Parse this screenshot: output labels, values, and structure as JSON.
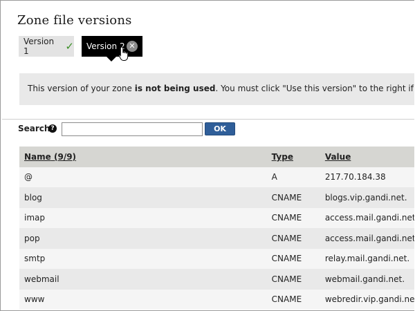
{
  "page": {
    "title": "Zone file versions"
  },
  "tabs": [
    {
      "label": "Version 1",
      "status_icon": "checkmark-icon"
    },
    {
      "label": "Version 2",
      "status_icon": "close-icon",
      "active": true
    }
  ],
  "notice": {
    "before": "This version of your zone ",
    "emphasis": "is not being used",
    "after": ". You must click \"Use this version\" to the right if you want to"
  },
  "search": {
    "label": "Search",
    "help_icon": "help-icon",
    "value": "",
    "ok_label": "OK"
  },
  "table": {
    "headers": {
      "name": "Name",
      "count": "(9/9)",
      "type": "Type",
      "value": "Value"
    },
    "rows": [
      {
        "name": "@",
        "type": "A",
        "value": "217.70.184.38"
      },
      {
        "name": "blog",
        "type": "CNAME",
        "value": "blogs.vip.gandi.net."
      },
      {
        "name": "imap",
        "type": "CNAME",
        "value": "access.mail.gandi.net."
      },
      {
        "name": "pop",
        "type": "CNAME",
        "value": "access.mail.gandi.net."
      },
      {
        "name": "smtp",
        "type": "CNAME",
        "value": "relay.mail.gandi.net."
      },
      {
        "name": "webmail",
        "type": "CNAME",
        "value": "webmail.gandi.net."
      },
      {
        "name": "www",
        "type": "CNAME",
        "value": "webredir.vip.gandi.net."
      }
    ]
  },
  "colors": {
    "active_tab": "#000000",
    "ok_button": "#2f5e99",
    "check": "#3a8f25"
  }
}
